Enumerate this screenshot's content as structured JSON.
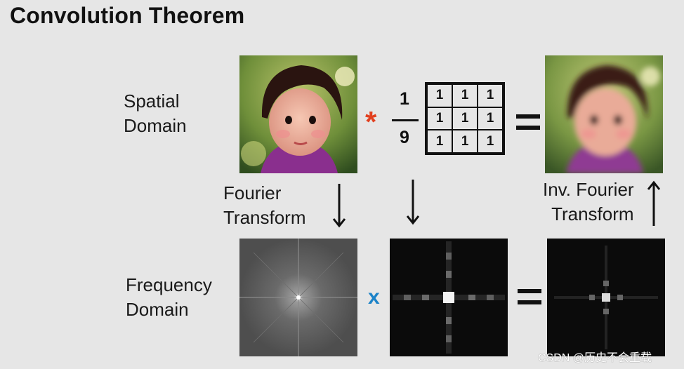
{
  "title": "Convolution Theorem",
  "labels": {
    "spatial": [
      "Spatial",
      "Domain"
    ],
    "frequency": [
      "Frequency",
      "Domain"
    ],
    "fourier": [
      "Fourier",
      "Transform"
    ],
    "inv_fourier": [
      "Inv. Fourier",
      "Transform"
    ]
  },
  "operators": {
    "convolve": "*",
    "multiply": "x",
    "fraction_numerator": "1",
    "fraction_denominator": "9"
  },
  "kernel": {
    "rows": [
      [
        "1",
        "1",
        "1"
      ],
      [
        "1",
        "1",
        "1"
      ],
      [
        "1",
        "1",
        "1"
      ]
    ]
  },
  "images": {
    "original_photo": "toddler-portrait",
    "blurred_photo": "toddler-portrait-blurred",
    "fft_original": "frequency-spectrum",
    "fft_kernel": "box-filter-spectrum",
    "fft_result": "filtered-spectrum"
  },
  "colors": {
    "background": "#e6e6e6",
    "convolve_star": "#e2401f",
    "multiply_x": "#1c83c8"
  },
  "watermark": "CSDN @历史不会重载"
}
